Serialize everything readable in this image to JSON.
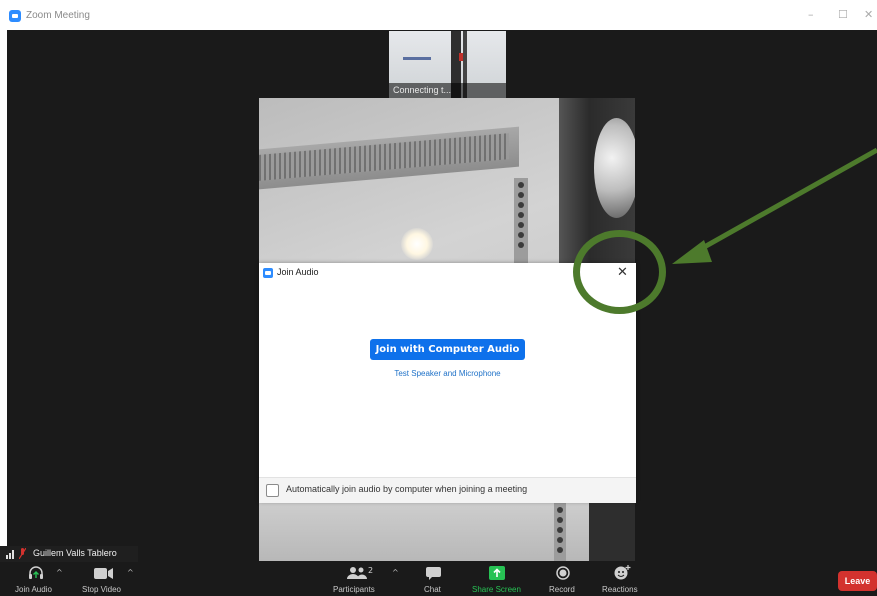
{
  "window": {
    "title": "Zoom Meeting",
    "minimize_label": "–",
    "maximize_label": "☐",
    "close_label": "✕"
  },
  "thumbnail": {
    "caption": "Connecting t..."
  },
  "dialog": {
    "title": "Join Audio",
    "close_label": "✕",
    "primary_button": "Join with Computer Audio",
    "test_link": "Test Speaker and Microphone",
    "auto_join_label": "Automatically join audio by computer when joining a meeting",
    "auto_join_checked": false
  },
  "participant": {
    "name": "Guillem Valls Tablero"
  },
  "toolbar": {
    "join_audio": "Join Audio",
    "stop_video": "Stop Video",
    "participants": "Participants",
    "participants_count": "2",
    "chat": "Chat",
    "share_screen": "Share Screen",
    "record": "Record",
    "reactions": "Reactions",
    "leave": "Leave",
    "caret": "^"
  },
  "colors": {
    "accent_blue": "#0e71eb",
    "share_green": "#27c254",
    "leave_red": "#d3322e",
    "annotation_green": "#4d7a2c"
  }
}
